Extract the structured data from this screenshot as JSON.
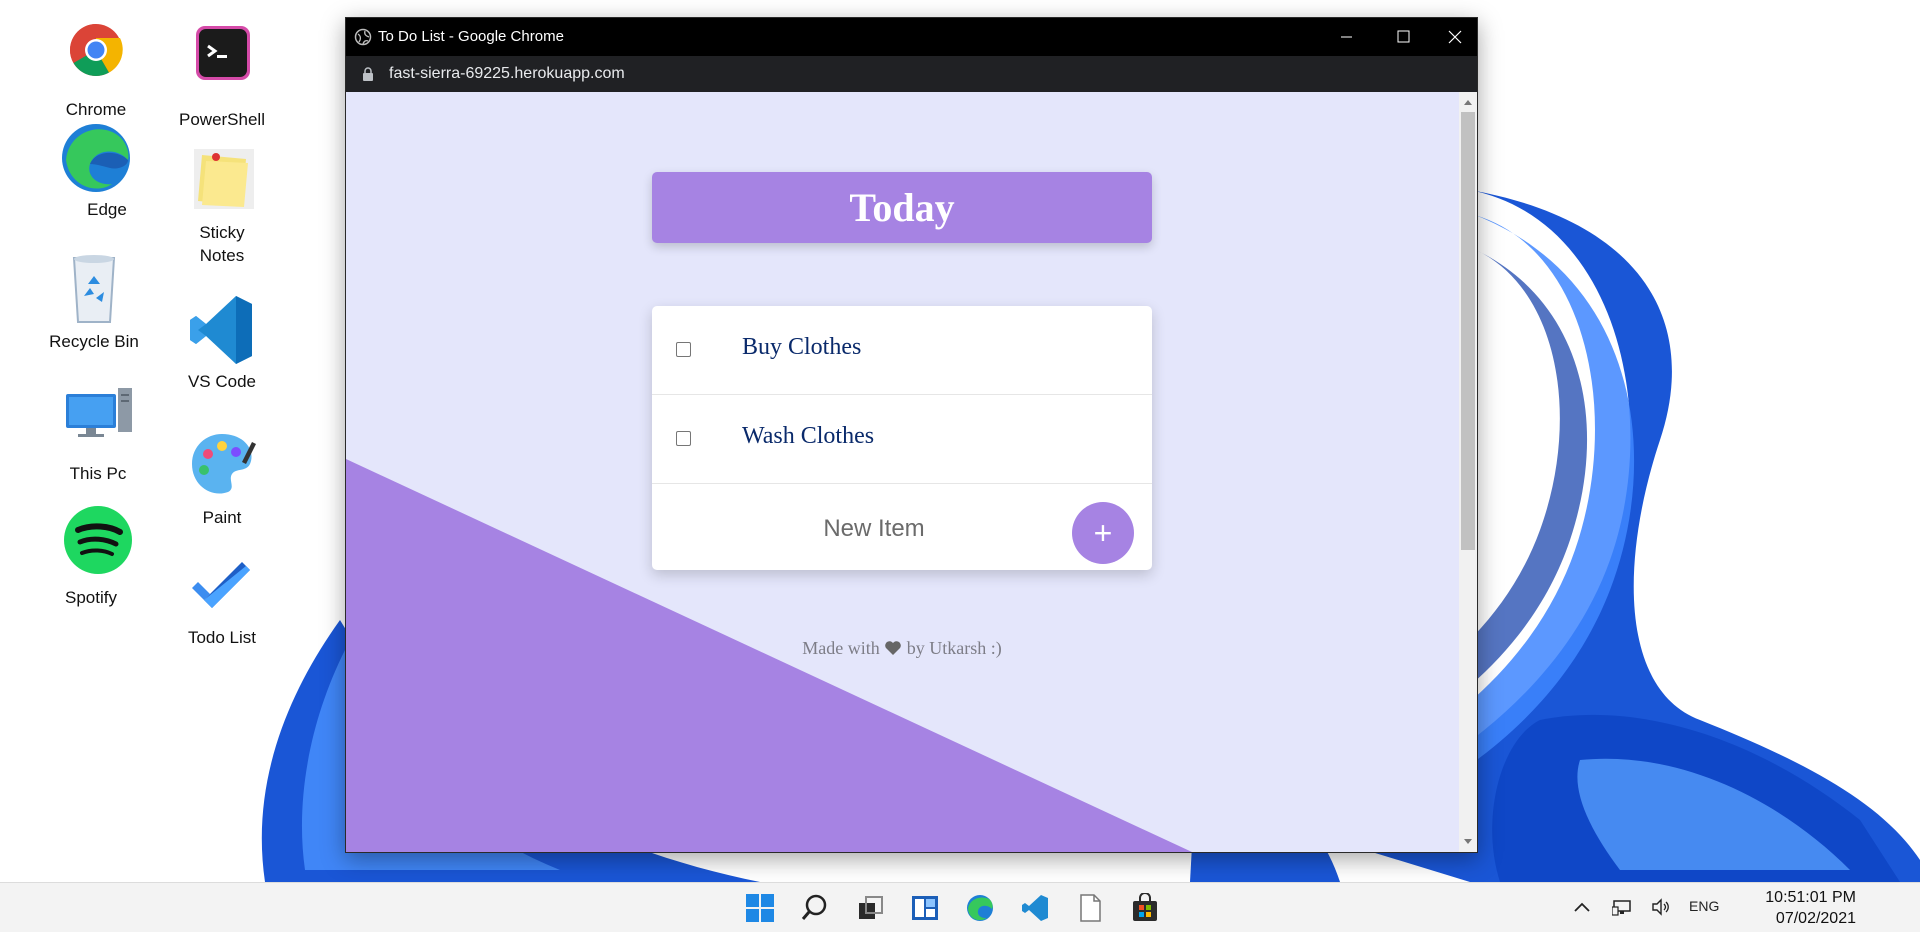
{
  "desktop": {
    "icons": [
      {
        "label": "Chrome"
      },
      {
        "label": "PowerShell"
      },
      {
        "label": "Edge"
      },
      {
        "label": "Sticky\nNotes"
      },
      {
        "label": "Recycle Bin"
      },
      {
        "label": "VS Code"
      },
      {
        "label": "This Pc"
      },
      {
        "label": "Paint"
      },
      {
        "label": "Spotify"
      },
      {
        "label": "Todo List"
      }
    ]
  },
  "window": {
    "title": "To Do List - Google Chrome",
    "url": "fast-sierra-69225.herokuapp.com"
  },
  "page": {
    "heading": "Today",
    "items": [
      {
        "text": "Buy Clothes",
        "checked": false
      },
      {
        "text": "Wash Clothes",
        "checked": false
      }
    ],
    "new_item_placeholder": "New Item",
    "add_button_label": "+",
    "footer_prefix": "Made with",
    "footer_suffix": "by Utkarsh :)"
  },
  "taskbar": {
    "language": "ENG",
    "time": "10:51:01 PM",
    "date": "07/02/2021"
  },
  "colors": {
    "accent_purple": "#a683e3",
    "page_background": "#e4e6fb",
    "item_text": "#0a2a6b"
  }
}
